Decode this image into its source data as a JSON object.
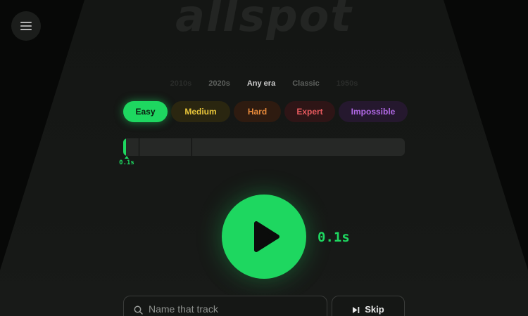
{
  "app": {
    "logo_text": "allspot"
  },
  "menu": {
    "icon": "hamburger-menu-icon"
  },
  "eras": {
    "items": [
      {
        "label": "2010s"
      },
      {
        "label": "2020s"
      },
      {
        "label": "Any era"
      },
      {
        "label": "Classic"
      },
      {
        "label": "1950s"
      }
    ],
    "selected": "Any era"
  },
  "difficulty": {
    "selected": "Easy",
    "options": [
      {
        "label": "Easy",
        "color": "#1ed760"
      },
      {
        "label": "Medium",
        "color": "#e8c53a"
      },
      {
        "label": "Hard",
        "color": "#e88a3a"
      },
      {
        "label": "Expert",
        "color": "#e85a5e"
      },
      {
        "label": "Impossible",
        "color": "#b36ae8"
      }
    ]
  },
  "progress": {
    "fill_fraction": 0.006,
    "marker_label": "0.1s",
    "segment_fractions": [
      0.055,
      0.2425
    ]
  },
  "player": {
    "time_label": "0.1s",
    "play_icon": "play-icon"
  },
  "guess": {
    "placeholder": "Name that track",
    "value": "",
    "search_icon": "search-icon"
  },
  "skip": {
    "label": "Skip",
    "icon": "skip-forward-icon"
  },
  "colors": {
    "accent": "#1ed760",
    "background": "#070807",
    "panel": "#161816"
  }
}
